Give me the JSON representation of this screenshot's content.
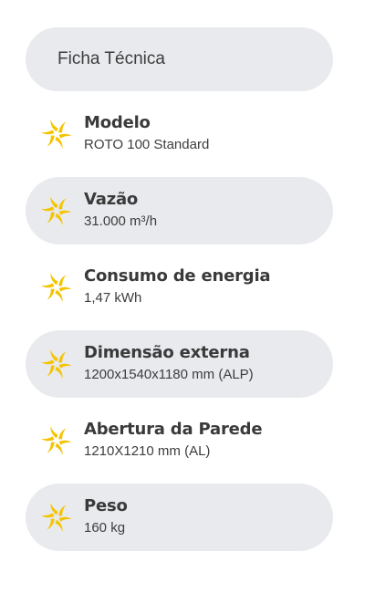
{
  "header": {
    "title": "Ficha Técnica"
  },
  "icon": {
    "name": "fan-icon",
    "color": "#F5C400"
  },
  "specs": [
    {
      "label": "Modelo",
      "value": "ROTO 100 Standard",
      "shaded": false
    },
    {
      "label": "Vazão",
      "value": "31.000 m³/h",
      "shaded": true
    },
    {
      "label": "Consumo de energia",
      "value": "1,47 kWh",
      "shaded": false
    },
    {
      "label": "Dimensão externa",
      "value": "1200x1540x1180 mm (ALP)",
      "shaded": true
    },
    {
      "label": "Abertura da Parede",
      "value": "1210X1210 mm (AL)",
      "shaded": false
    },
    {
      "label": "Peso",
      "value": "160 kg",
      "shaded": true
    }
  ],
  "colors": {
    "pill_background": "#e8eaee",
    "text": "#3a3a3a"
  }
}
